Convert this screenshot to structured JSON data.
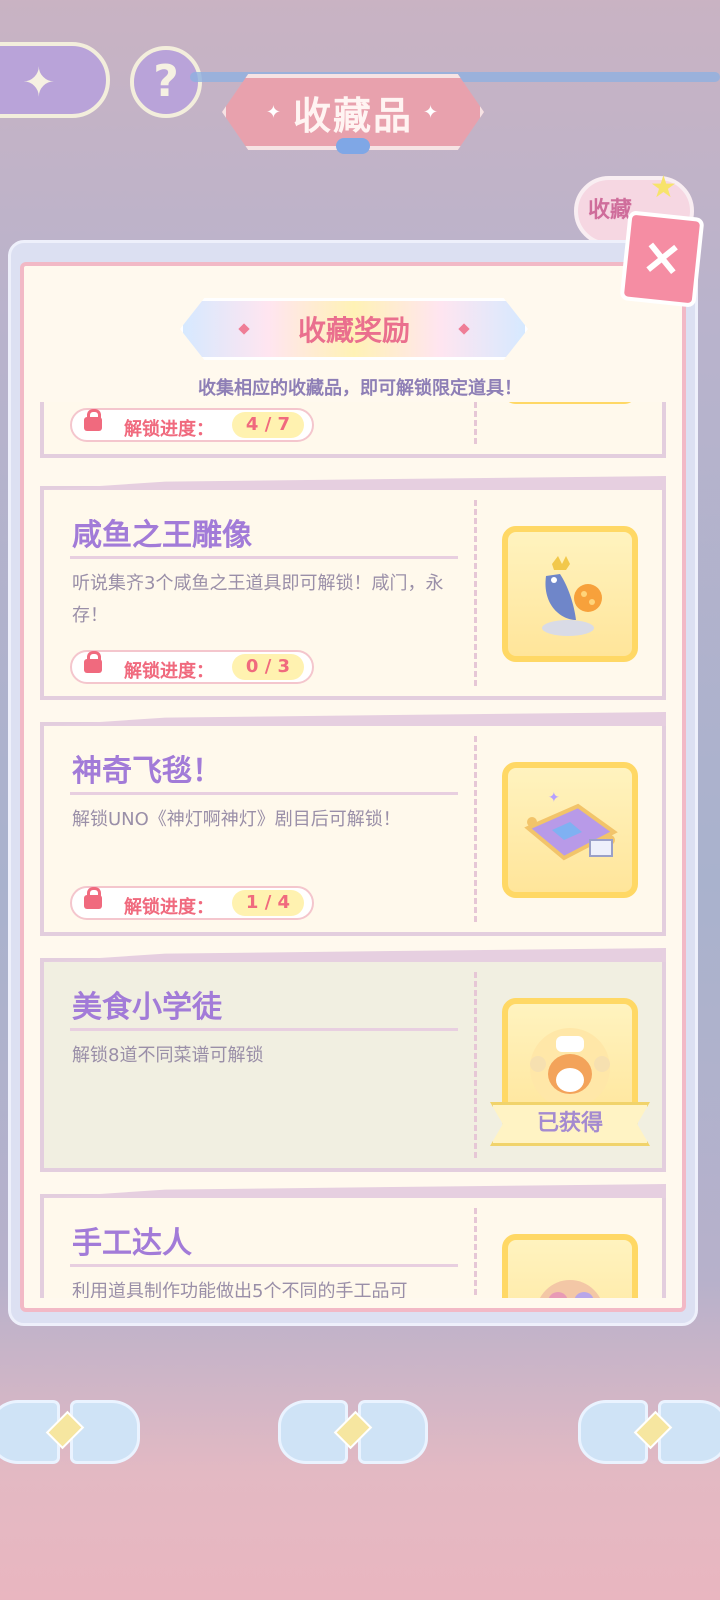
{
  "header": {
    "title": "收藏品",
    "back_icon": "back-arrow-icon",
    "help_label": "?",
    "side_tab_label": "收藏"
  },
  "dialog": {
    "title": "收藏奖励",
    "hint": "收集相应的收藏品，即可解锁限定道具！",
    "close_label": "×",
    "progress_label": "解锁进度：",
    "items": [
      {
        "name": "",
        "desc": "",
        "progress": "4 / 7",
        "state": "locked"
      },
      {
        "name": "咸鱼之王雕像",
        "desc": "听说集齐3个咸鱼之王道具即可解锁！咸门，永存！",
        "progress": "0 / 3",
        "state": "locked",
        "icon": "fish-king-statue-icon"
      },
      {
        "name": "神奇飞毯！",
        "desc": "解锁UNO《神灯啊神灯》剧目后可解锁！",
        "progress": "1 / 4",
        "state": "locked",
        "icon": "magic-carpet-icon"
      },
      {
        "name": "美食小学徒",
        "desc": "解锁8道不同菜谱可解锁",
        "state": "obtained",
        "badge": "已获得",
        "icon": "chef-hamster-icon"
      },
      {
        "name": "手工达人",
        "desc": "利用道具制作功能做出5个不同的手工品可",
        "state": "locked",
        "icon": "craft-cat-icon"
      }
    ]
  },
  "colors": {
    "accent_purple": "#a27bd8",
    "progress_red": "#f06a7e",
    "panel_border_pink": "#f2b9c6",
    "gold": "#ffd865"
  }
}
